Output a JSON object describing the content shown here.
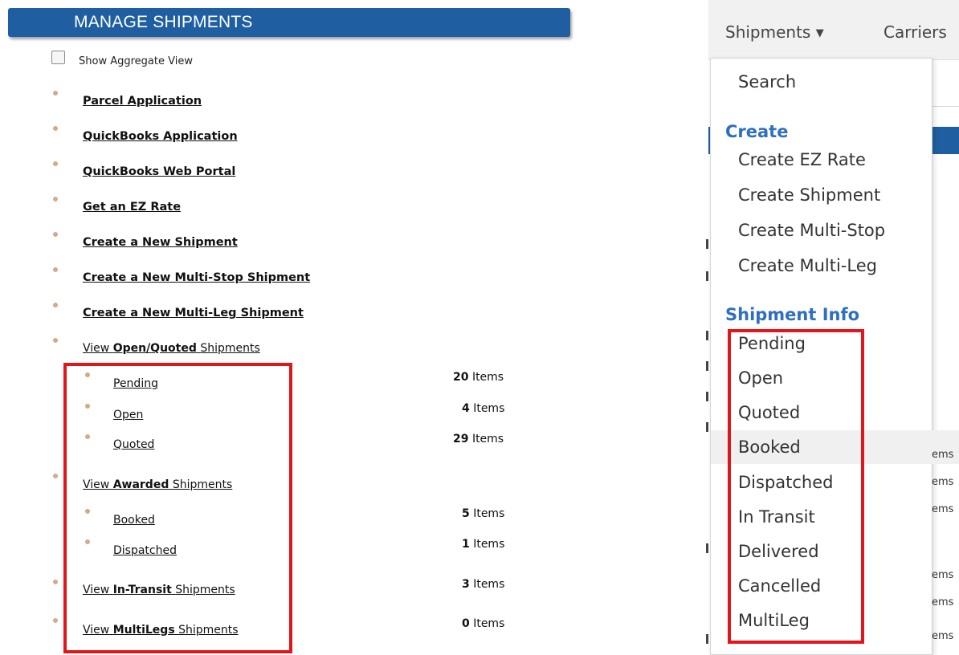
{
  "left_panel": {
    "header_title": "MANAGE SHIPMENTS",
    "aggregate_label": "Show Aggregate View",
    "links": [
      "Parcel Application",
      "QuickBooks Application",
      "QuickBooks Web Portal",
      "Get an EZ Rate",
      "Create a New Shipment",
      "Create a New Multi-Stop Shipment",
      "Create a New Multi-Leg Shipment"
    ],
    "word_view": "View",
    "word_shipments": "Shipments",
    "groups": {
      "open_quoted": "Open/Quoted",
      "awarded": "Awarded",
      "in_transit": "In-Transit",
      "multilegs": "MultiLegs"
    },
    "sub_items": {
      "pending": {
        "label": "Pending",
        "count": "20",
        "unit": "Items"
      },
      "open": {
        "label": "Open",
        "count": "4",
        "unit": "Items"
      },
      "quoted": {
        "label": "Quoted",
        "count": "29",
        "unit": "Items"
      },
      "booked": {
        "label": "Booked",
        "count": "5",
        "unit": "Items"
      },
      "dispatched": {
        "label": "Dispatched",
        "count": "1",
        "unit": "Items"
      }
    },
    "in_transit_count": {
      "count": "3",
      "unit": "Items"
    },
    "multilegs_count": {
      "count": "0",
      "unit": "Items"
    }
  },
  "right_panel": {
    "nav_shipments": "Shipments",
    "nav_carriers": "Carriers",
    "dropdown": {
      "search": "Search",
      "create_header": "Create",
      "create_items": [
        "Create EZ Rate",
        "Create Shipment",
        "Create Multi-Stop",
        "Create Multi-Leg"
      ],
      "info_header": "Shipment Info",
      "info_items": [
        "Pending",
        "Open",
        "Quoted",
        "Booked",
        "Dispatched",
        "In Transit",
        "Delivered",
        "Cancelled",
        "MultiLeg"
      ]
    },
    "peek_text": "ems"
  },
  "colors": {
    "header_blue": "#1f5fa1",
    "bullet": "#d2ab88",
    "highlight_red": "#e2151b",
    "menu_header_blue": "#2e6fbf"
  }
}
